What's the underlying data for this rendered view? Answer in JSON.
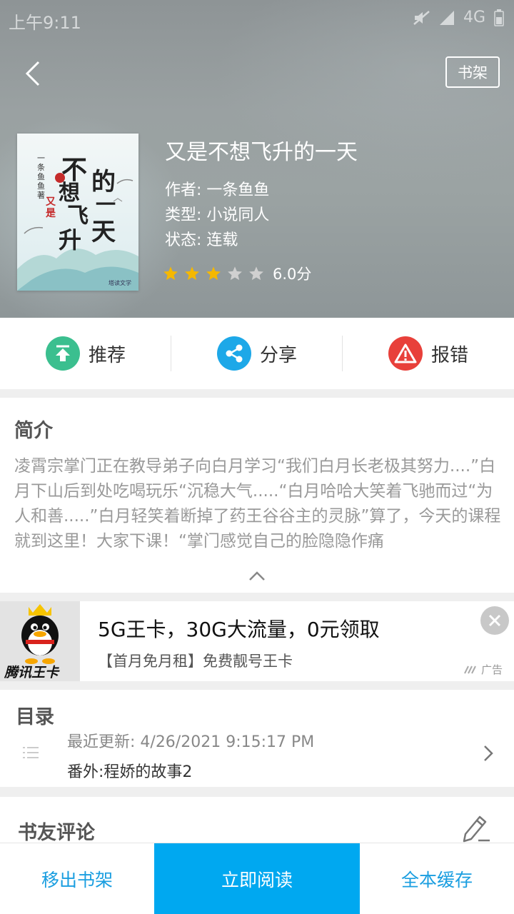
{
  "status_bar": {
    "time": "上午9:11",
    "network": "4G"
  },
  "header": {
    "shelf_button": "书架"
  },
  "book": {
    "title": "又是不想飞升的一天",
    "author_line": "作者: 一条鱼鱼",
    "type_line": "类型: 小说同人",
    "status_line": "状态: 连载",
    "rating_stars": 3,
    "rating_max": 5,
    "score": "6.0分",
    "cover": {
      "title_chars": [
        "不",
        "想",
        "飞",
        "升",
        "的",
        "一",
        "天"
      ],
      "prefix": "又是",
      "author_vertical": "一条鱼鱼著",
      "publisher": "塔读文学"
    }
  },
  "actions": [
    {
      "label": "推荐",
      "icon": "recommend-icon",
      "color": "#3bbf8f"
    },
    {
      "label": "分享",
      "icon": "share-icon",
      "color": "#1da8e8"
    },
    {
      "label": "报错",
      "icon": "report-icon",
      "color": "#e8403a"
    }
  ],
  "intro": {
    "title": "简介",
    "text": "凌霄宗掌门正在教导弟子向白月学习“我们白月长老极其努力....”白月下山后到处吃喝玩乐“沉稳大气.....“白月哈哈大笑着飞驰而过“为人和善.....”白月轻笑着断掉了药王谷谷主的灵脉”算了，今天的课程就到这里！大家下课！“掌门感觉自己的脸隐隐作痛"
  },
  "ad": {
    "title": "5G王卡，30G大流量，0元领取",
    "subtitle": "【首月免月租】免费靓号王卡",
    "image_text": "腾讯王卡",
    "tag": "广告"
  },
  "catalog": {
    "title": "目录",
    "latest_update": "最近更新: 4/26/2021 9:15:17 PM",
    "latest_chapter": "番外:程娇的故事2"
  },
  "comments": {
    "title": "书友评论"
  },
  "bottom_bar": {
    "remove": "移出书架",
    "read": "立即阅读",
    "cache": "全本缓存"
  },
  "colors": {
    "accent": "#00a8f0",
    "star_on": "#f5b800",
    "star_off": "#d0d0d0"
  }
}
